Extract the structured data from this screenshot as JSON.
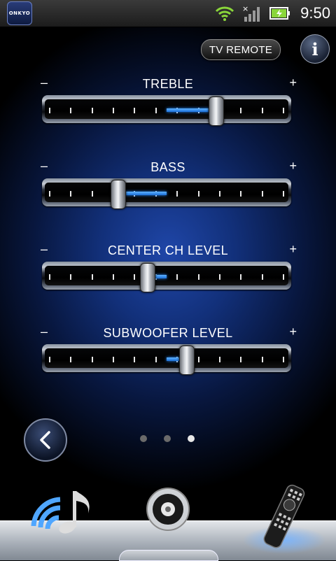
{
  "status_bar": {
    "logo_text": "ONKYO",
    "time": "9:50",
    "icons": [
      "wifi-icon",
      "signal-icon",
      "battery-charging-icon"
    ]
  },
  "header": {
    "tv_remote_label": "TV REMOTE",
    "info_label": "i"
  },
  "sliders": [
    {
      "label": "TREBLE",
      "minus": "–",
      "plus": "+",
      "value_fraction": 0.7,
      "center_fraction": 0.5
    },
    {
      "label": "BASS",
      "minus": "–",
      "plus": "+",
      "value_fraction": 0.3,
      "center_fraction": 0.5
    },
    {
      "label": "CENTER CH LEVEL",
      "minus": "–",
      "plus": "+",
      "value_fraction": 0.42,
      "center_fraction": 0.5
    },
    {
      "label": "SUBWOOFER LEVEL",
      "minus": "–",
      "plus": "+",
      "value_fraction": 0.58,
      "center_fraction": 0.5
    }
  ],
  "pager": {
    "count": 3,
    "active_index": 2
  },
  "bottom_nav": {
    "items": [
      "music-network-icon",
      "speaker-icon",
      "remote-control-icon"
    ],
    "active_index": 2
  },
  "colors": {
    "accent_blue": "#2a8cff",
    "background_blue": "#1f46a8"
  }
}
